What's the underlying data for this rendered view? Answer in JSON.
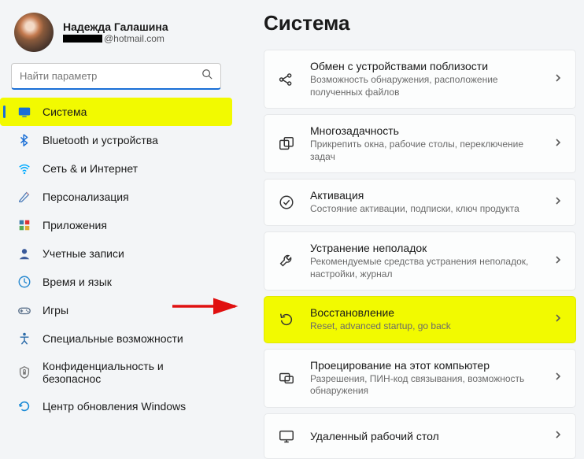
{
  "profile": {
    "name": "Надежда Галашина",
    "email_domain": "@hotmail.com"
  },
  "search": {
    "placeholder": "Найти параметр"
  },
  "sidebar": {
    "items": [
      {
        "label": "Система",
        "icon": "system",
        "color": "#1a6fd6"
      },
      {
        "label": "Bluetooth и устройства",
        "icon": "bluetooth",
        "color": "#1a6fd6"
      },
      {
        "label": "Сеть & и Интернет",
        "icon": "network",
        "color": "#00aaff"
      },
      {
        "label": "Персонализация",
        "icon": "personalization",
        "color": "#4a7ab8"
      },
      {
        "label": "Приложения",
        "icon": "apps",
        "color": "#3a7aa8"
      },
      {
        "label": "Учетные записи",
        "icon": "accounts",
        "color": "#3a5a9a"
      },
      {
        "label": "Время и язык",
        "icon": "time",
        "color": "#2a8ad0"
      },
      {
        "label": "Игры",
        "icon": "gaming",
        "color": "#5a708a"
      },
      {
        "label": "Специальные возможности",
        "icon": "accessibility",
        "color": "#2a6aa8"
      },
      {
        "label": "Конфиденциальность и безопаснос",
        "icon": "privacy",
        "color": "#7a7a7a"
      },
      {
        "label": "Центр обновления Windows",
        "icon": "update",
        "color": "#1a8ad6"
      }
    ]
  },
  "main": {
    "title": "Система",
    "cards": [
      {
        "title": "Обмен с устройствами поблизости",
        "sub": "Возможность обнаружения, расположение полученных файлов",
        "icon": "share"
      },
      {
        "title": "Многозадачность",
        "sub": "Прикрепить окна, рабочие столы, переключение задач",
        "icon": "multitask"
      },
      {
        "title": "Активация",
        "sub": "Состояние активации, подписки, ключ продукта",
        "icon": "activation"
      },
      {
        "title": "Устранение неполадок",
        "sub": "Рекомендуемые средства устранения неполадок, настройки, журнал",
        "icon": "troubleshoot"
      },
      {
        "title": "Восстановление",
        "sub": "Reset, advanced startup, go back",
        "icon": "recovery",
        "highlight": true
      },
      {
        "title": "Проецирование на этот компьютер",
        "sub": "Разрешения, ПИН-код связывания, возможность обнаружения",
        "icon": "project"
      },
      {
        "title": "Удаленный рабочий стол",
        "sub": "",
        "icon": "remote"
      }
    ]
  }
}
